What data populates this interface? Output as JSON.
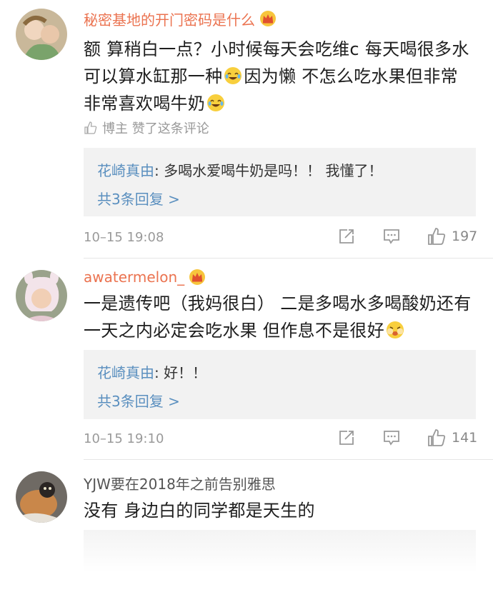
{
  "comments": [
    {
      "username": "秘密基地的开门密码是什么",
      "text_1": "额 算稍白一点？小时候每天会吃维c 每天喝很多水 可以算水缸那一种",
      "text_2": "因为懒 不怎么吃水果但非常非常喜欢喝牛奶",
      "liked_by": "博主 赞了这条评论",
      "reply_user": "花崎真由",
      "reply_text": ": 多喝水爱喝牛奶是吗！！ 我懂了！",
      "reply_more": "共3条回复 >",
      "time": "10–15 19:08",
      "likes": "197"
    },
    {
      "username": "awatermelon_",
      "text_1": "一是遗传吧（我妈很白） 二是多喝水多喝酸奶还有一天之内必定会吃水果 但作息不是很好",
      "reply_user": "花崎真由",
      "reply_text": ": 好！！",
      "reply_more": "共3条回复 >",
      "time": "10–15 19:10",
      "likes": "141"
    },
    {
      "username": "YJW要在2018年之前告别雅思",
      "text_1": "没有 身边白的同学都是天生的"
    }
  ],
  "icons": {
    "crown": "crown-icon",
    "thumb": "thumb-up-icon",
    "share": "share-icon",
    "reply": "comment-icon",
    "emoji_laugh": "laugh-cry-emoji",
    "emoji_blush": "blush-emoji"
  },
  "colors": {
    "username": "#eb7350",
    "link": "#5a8fbf",
    "meta": "#9a9a9a",
    "reply_bg": "#f2f2f2"
  }
}
